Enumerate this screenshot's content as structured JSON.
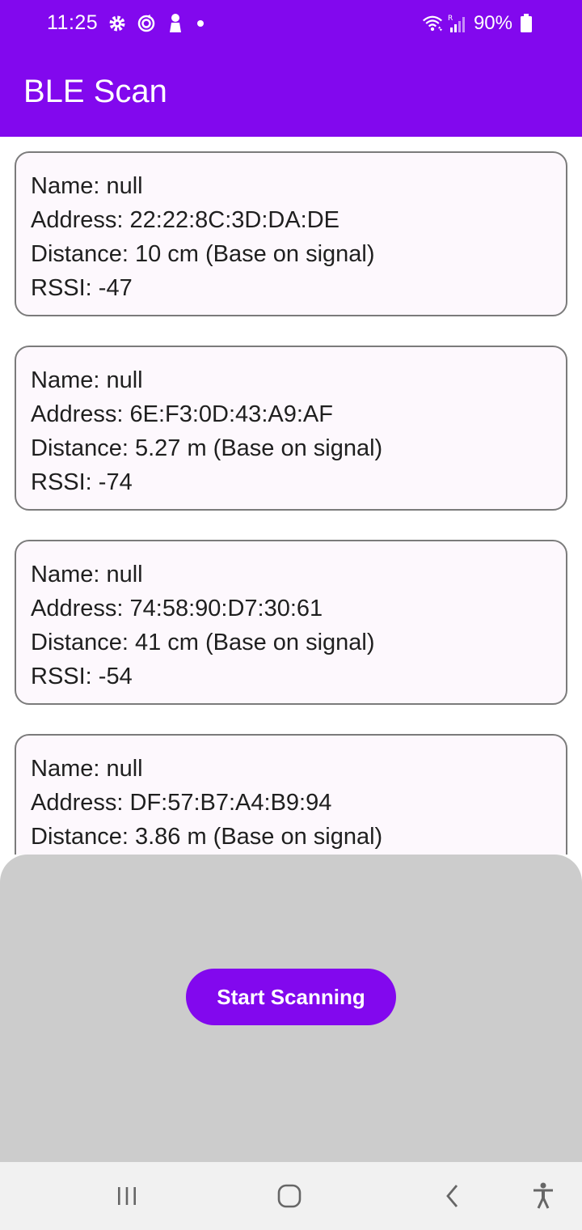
{
  "status_bar": {
    "time": "11:25",
    "left_icons": [
      "settings-icon",
      "sync-icon",
      "person-icon",
      "notification-dot"
    ],
    "right_icons": [
      "wifi-icon",
      "signal-icon",
      "battery-icon"
    ],
    "battery": "90%"
  },
  "app_bar": {
    "title": "BLE Scan"
  },
  "devices": [
    {
      "name": "Name: null",
      "address": "Address: 22:22:8C:3D:DA:DE",
      "distance": "Distance: 10 cm (Base on signal)",
      "rssi": "RSSI: -47"
    },
    {
      "name": "Name: null",
      "address": "Address: 6E:F3:0D:43:A9:AF",
      "distance": "Distance: 5.27 m (Base on signal)",
      "rssi": "RSSI: -74"
    },
    {
      "name": "Name: null",
      "address": "Address: 74:58:90:D7:30:61",
      "distance": "Distance: 41 cm (Base on signal)",
      "rssi": "RSSI: -54"
    },
    {
      "name": "Name: null",
      "address": "Address: DF:57:B7:A4:B9:94",
      "distance": "Distance: 3.86 m (Base on signal)",
      "rssi": ""
    }
  ],
  "bottom_sheet": {
    "button_label": "Start Scanning"
  },
  "nav_bar": {
    "items": [
      "recents-icon",
      "home-icon",
      "back-icon",
      "accessibility-icon"
    ]
  },
  "colors": {
    "primary": "#8208ee",
    "card_bg": "#fdf8fd",
    "sheet_bg": "#cccccc",
    "nav_bg": "#f1f1f1"
  }
}
